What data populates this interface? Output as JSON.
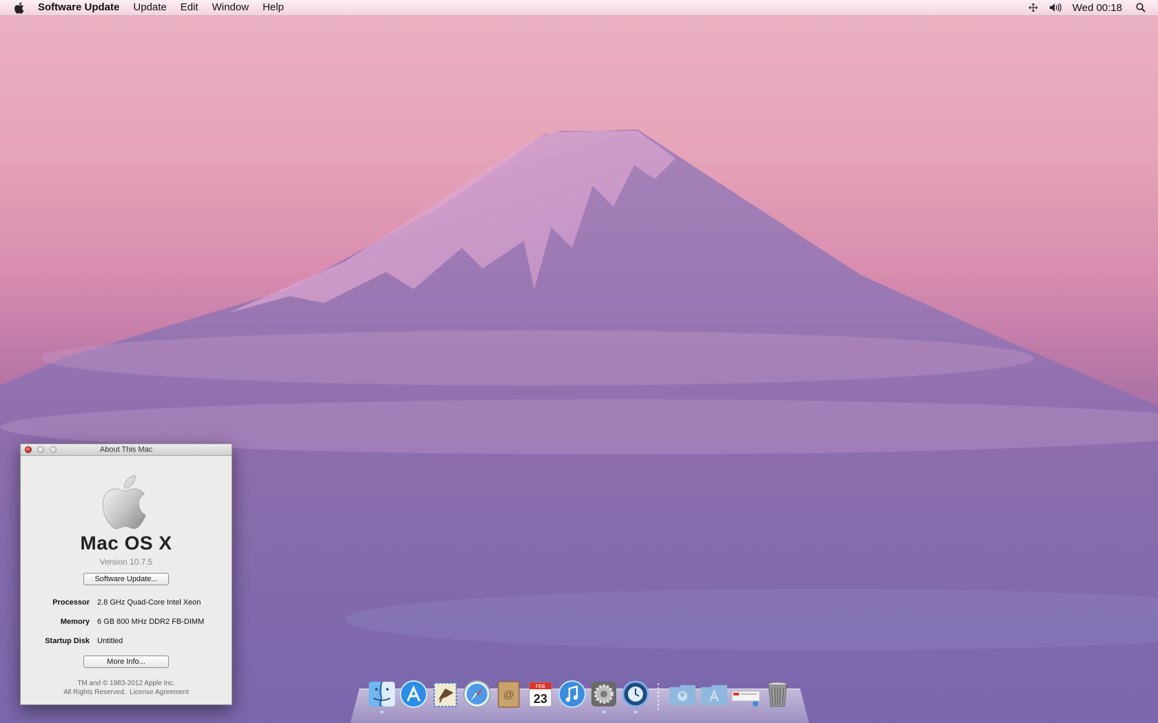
{
  "menubar": {
    "app_name": "Software Update",
    "items": [
      "Update",
      "Edit",
      "Window",
      "Help"
    ],
    "clock": "Wed 00:18"
  },
  "about_window": {
    "title": "About This Mac",
    "os_name": "Mac OS X",
    "version": "Version 10.7.5",
    "software_update_button": "Software Update...",
    "processor_label": "Processor",
    "processor_value": "2.8 GHz Quad-Core Intel Xeon",
    "memory_label": "Memory",
    "memory_value": "6 GB 800 MHz DDR2 FB-DIMM",
    "startup_disk_label": "Startup Disk",
    "startup_disk_value": "Untitled",
    "more_info_button": "More Info...",
    "copyright_line1": "TM and © 1983-2012 Apple Inc.",
    "copyright_line2": "All Rights Reserved.",
    "license_link": "License Agreement"
  },
  "dock": {
    "items": [
      "finder-icon",
      "app-store-icon",
      "mail-icon",
      "safari-icon",
      "address-book-icon",
      "ical-icon",
      "itunes-icon",
      "system-preferences-icon",
      "time-machine-icon",
      "documents-stack-icon",
      "applications-stack-icon",
      "downloads-stack-icon",
      "trash-icon"
    ],
    "calendar_month": "FEB",
    "calendar_day": "23"
  }
}
